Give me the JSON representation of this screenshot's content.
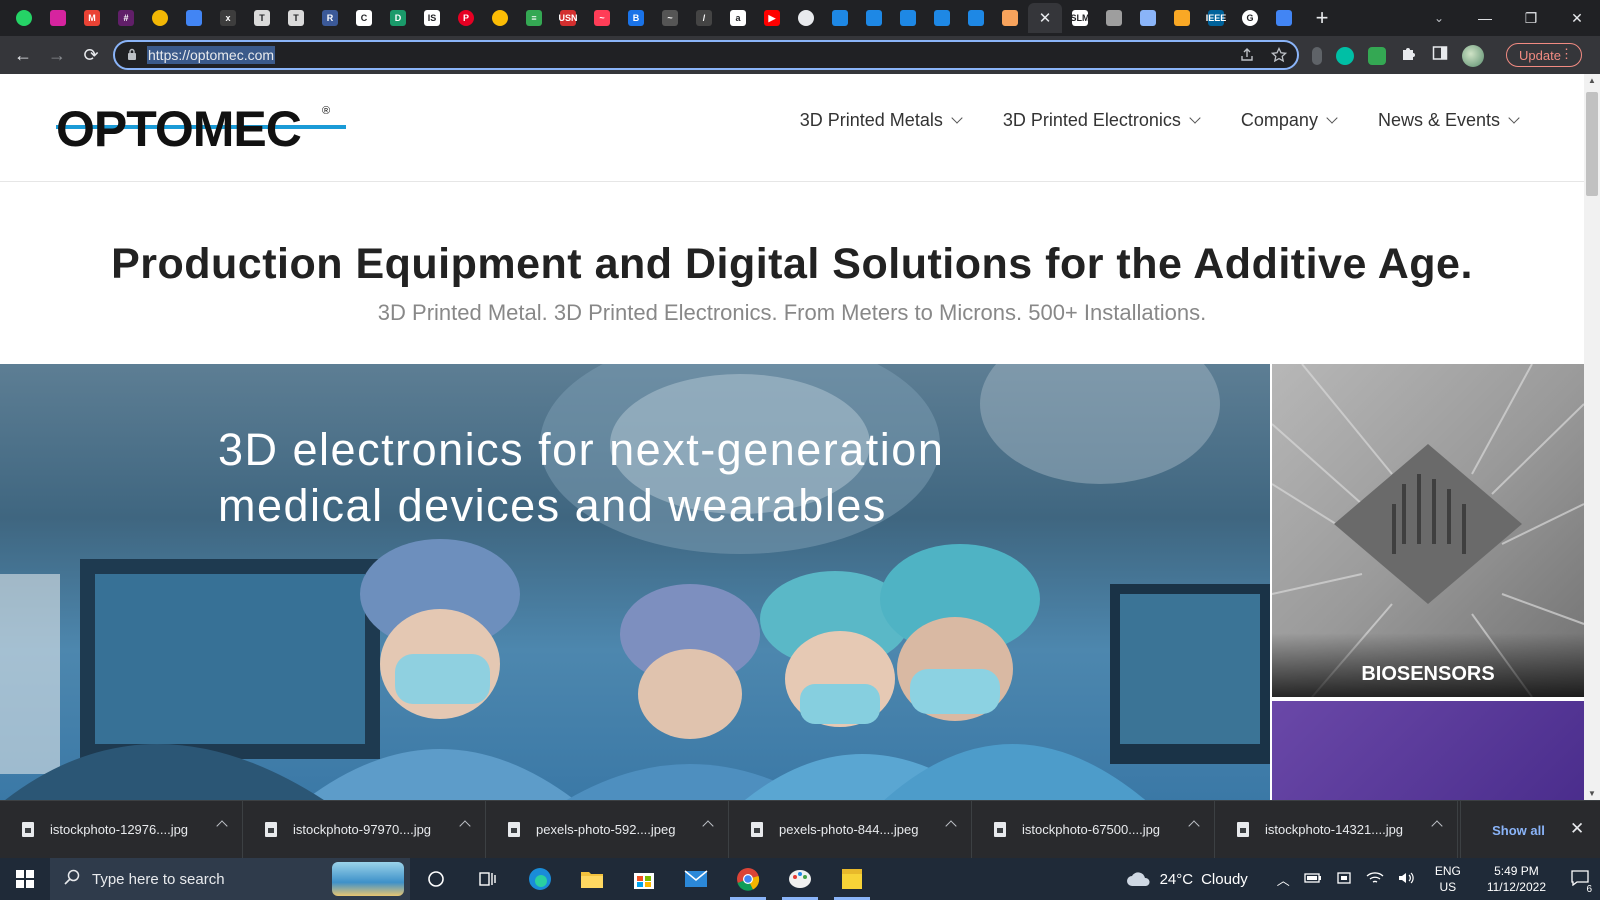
{
  "browser": {
    "tabs": [
      {
        "icon": "whatsapp-icon",
        "color": "#25d366",
        "glyph": "",
        "shape": "round"
      },
      {
        "icon": "instagram-icon",
        "color": "#d6249f",
        "glyph": "",
        "shape": "square"
      },
      {
        "icon": "gmail-icon",
        "color": "#ea4335",
        "glyph": "M",
        "shape": "square"
      },
      {
        "icon": "slack-icon",
        "color": "#611f69",
        "glyph": "#",
        "shape": "square"
      },
      {
        "icon": "cloud-icon",
        "color": "#f2b705",
        "glyph": "",
        "shape": "round"
      },
      {
        "icon": "docs-icon",
        "color": "#4285f4",
        "glyph": "",
        "shape": "square"
      },
      {
        "icon": "x-icon",
        "color": "#3d3d3d",
        "glyph": "x",
        "shape": "square"
      },
      {
        "icon": "t-icon",
        "color": "#dadada",
        "glyph": "T",
        "shape": "square"
      },
      {
        "icon": "t-icon",
        "color": "#dadada",
        "glyph": "T",
        "shape": "square"
      },
      {
        "icon": "r-icon",
        "color": "#3b5998",
        "glyph": "R",
        "shape": "square"
      },
      {
        "icon": "c-icon",
        "color": "#ffffff",
        "glyph": "C",
        "shape": "square"
      },
      {
        "icon": "d-icon",
        "color": "#1a9a6a",
        "glyph": "D",
        "shape": "square"
      },
      {
        "icon": "is-icon",
        "color": "#ffffff",
        "glyph": "IS",
        "shape": "square"
      },
      {
        "icon": "pinterest-icon",
        "color": "#e60023",
        "glyph": "P",
        "shape": "round"
      },
      {
        "icon": "google-photos-icon",
        "color": "#fbbc05",
        "glyph": "",
        "shape": "round"
      },
      {
        "icon": "bars-icon",
        "color": "#34a853",
        "glyph": "≡",
        "shape": "square"
      },
      {
        "icon": "usn-icon",
        "color": "#d32f2f",
        "glyph": "USN",
        "shape": "square"
      },
      {
        "icon": "monday-icon",
        "color": "#ff3d57",
        "glyph": "~",
        "shape": "square"
      },
      {
        "icon": "b-icon",
        "color": "#1a73e8",
        "glyph": "B",
        "shape": "square"
      },
      {
        "icon": "wave-icon",
        "color": "#555555",
        "glyph": "~",
        "shape": "square"
      },
      {
        "icon": "pen-icon",
        "color": "#444444",
        "glyph": "/",
        "shape": "square"
      },
      {
        "icon": "amazon-icon",
        "color": "#ffffff",
        "glyph": "a",
        "shape": "square"
      },
      {
        "icon": "youtube-icon",
        "color": "#ff0000",
        "glyph": "▶",
        "shape": "square"
      },
      {
        "icon": "circle-icon",
        "color": "#e8eaed",
        "glyph": "",
        "shape": "round"
      },
      {
        "icon": "pinwheel-icon",
        "color": "#1e88e5",
        "glyph": "",
        "shape": "square"
      },
      {
        "icon": "pinwheel-icon",
        "color": "#1e88e5",
        "glyph": "",
        "shape": "square"
      },
      {
        "icon": "pinwheel-icon",
        "color": "#1e88e5",
        "glyph": "",
        "shape": "square"
      },
      {
        "icon": "pinwheel-icon",
        "color": "#1e88e5",
        "glyph": "",
        "shape": "square"
      },
      {
        "icon": "pinwheel-icon",
        "color": "#1e88e5",
        "glyph": "",
        "shape": "square"
      },
      {
        "icon": "orange-app-icon",
        "color": "#f7a35c",
        "glyph": "",
        "shape": "square"
      },
      {
        "icon": "close-icon",
        "color": "",
        "glyph": "✕",
        "shape": "active"
      },
      {
        "icon": "slm-icon",
        "color": "#ffffff",
        "glyph": "SLM",
        "shape": "square"
      },
      {
        "icon": "puzzle-icon",
        "color": "#9e9e9e",
        "glyph": "",
        "shape": "square"
      },
      {
        "icon": "globe-icon",
        "color": "#8ab4f8",
        "glyph": "",
        "shape": "square"
      },
      {
        "icon": "coin-icon",
        "color": "#f9a825",
        "glyph": "",
        "shape": "square"
      },
      {
        "icon": "ieee-icon",
        "color": "#00629b",
        "glyph": "IEEE",
        "shape": "square"
      },
      {
        "icon": "google-icon",
        "color": "#ffffff",
        "glyph": "G",
        "shape": "round"
      },
      {
        "icon": "docs-icon",
        "color": "#4285f4",
        "glyph": "",
        "shape": "square"
      }
    ],
    "newtab_glyph": "+",
    "window_controls": {
      "tab_search": "⌄",
      "minimize": "—",
      "restore": "❐",
      "close": "✕"
    },
    "nav": {
      "back": "←",
      "forward": "→",
      "reload": "⟳"
    },
    "url": "https://optomec.com",
    "update_label": "Update"
  },
  "site": {
    "logo_text": "OPTOMEC",
    "logo_reg": "®",
    "nav": [
      {
        "label": "3D Printed Metals"
      },
      {
        "label": "3D Printed Electronics"
      },
      {
        "label": "Company"
      },
      {
        "label": "News & Events"
      }
    ],
    "hero_title": "Production Equipment and Digital Solutions for the Additive Age.",
    "hero_subtitle": "3D Printed Metal. 3D Printed Electronics. From Meters to Microns. 500+ Installations.",
    "slide_line1": "3D electronics for next-generation",
    "slide_line2": "medical devices and wearables",
    "tile_label": "BIOSENSORS"
  },
  "downloads": {
    "items": [
      {
        "name": "istockphoto-12976....jpg"
      },
      {
        "name": "istockphoto-97970....jpg"
      },
      {
        "name": "pexels-photo-592....jpeg"
      },
      {
        "name": "pexels-photo-844....jpeg"
      },
      {
        "name": "istockphoto-67500....jpg"
      },
      {
        "name": "istockphoto-14321....jpg"
      }
    ],
    "show_all": "Show all",
    "close": "✕"
  },
  "taskbar": {
    "search_placeholder": "Type here to search",
    "weather_temp": "24°C",
    "weather_desc": "Cloudy",
    "lang_1": "ENG",
    "lang_2": "US",
    "time": "5:49 PM",
    "date": "11/12/2022",
    "notif_count": "6"
  },
  "colors": {
    "accent": "#8ab4f8",
    "logo_blue": "#1a9bd7",
    "update_red": "#f28b82"
  }
}
